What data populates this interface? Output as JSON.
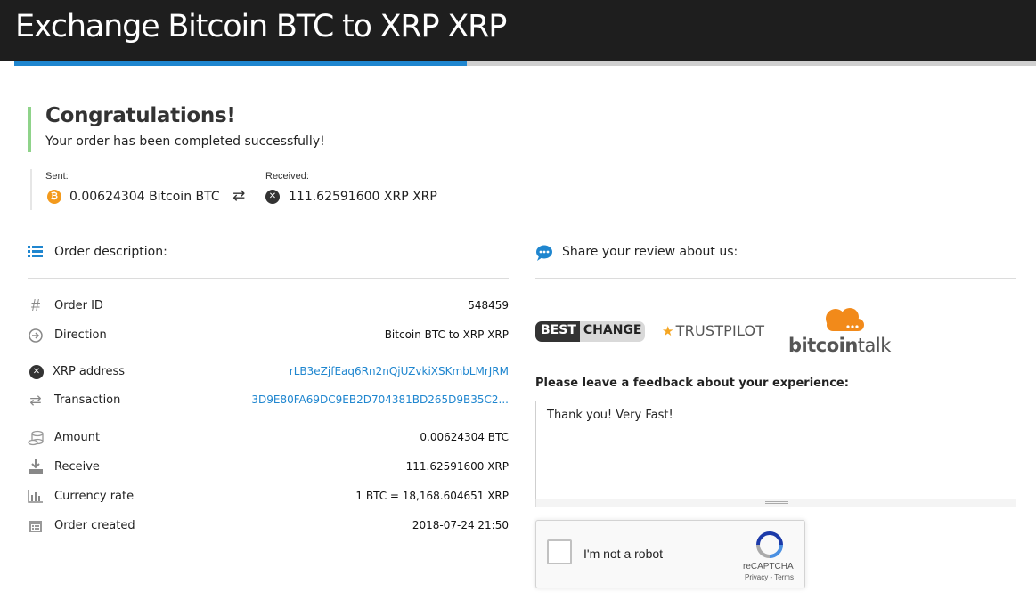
{
  "header": {
    "title": "Exchange Bitcoin BTC to XRP XRP"
  },
  "status": {
    "heading": "Congratulations!",
    "message": "Your order has been completed successfully!"
  },
  "summary": {
    "sent_label": "Sent:",
    "sent_amount": "0.00624304 Bitcoin BTC",
    "received_label": "Received:",
    "received_amount": "111.62591600 XRP XRP"
  },
  "order": {
    "heading": "Order description:",
    "rows": [
      {
        "label": "Order ID",
        "value": "548459",
        "icon": "hash-icon"
      },
      {
        "label": "Direction",
        "value": "Bitcoin BTC to XRP XRP",
        "icon": "arrow-circle-icon"
      },
      {
        "label": "XRP address",
        "value": "rLB3eZjfEaq6Rn2nQjUZvkiXSKmbLMrJRM",
        "icon": "xrp-icon"
      },
      {
        "label": "Transaction",
        "value": "3D9E80FA69DC9EB2D704381BD265D9B35C2...",
        "icon": "shuffle-icon"
      },
      {
        "label": "Amount",
        "value": "0.00624304 BTC",
        "icon": "coins-icon"
      },
      {
        "label": "Receive",
        "value": "111.62591600 XRP",
        "icon": "download-icon"
      },
      {
        "label": "Currency rate",
        "value": "1 BTC = 18,168.604651 XRP",
        "icon": "bar-chart-icon"
      },
      {
        "label": "Order created",
        "value": "2018-07-24 21:50",
        "icon": "calendar-icon"
      }
    ]
  },
  "review": {
    "heading": "Share your review about us:",
    "bestchange_a": "BEST",
    "bestchange_b": "CHANGE",
    "trustpilot": "TRUSTPILOT",
    "bitcointalk_a": "bitcoin",
    "bitcointalk_b": "talk",
    "feedback_label": "Please leave a feedback about your experience:",
    "feedback_value": "Thank you! Very Fast!"
  },
  "captcha": {
    "label": "I'm not a robot",
    "brand": "reCAPTCHA",
    "terms": "Privacy - Terms"
  },
  "colors": {
    "accent": "#1f86cf",
    "success": "#8fd38a",
    "btc": "#f39a1d",
    "header_bg": "#1e1e1e"
  }
}
